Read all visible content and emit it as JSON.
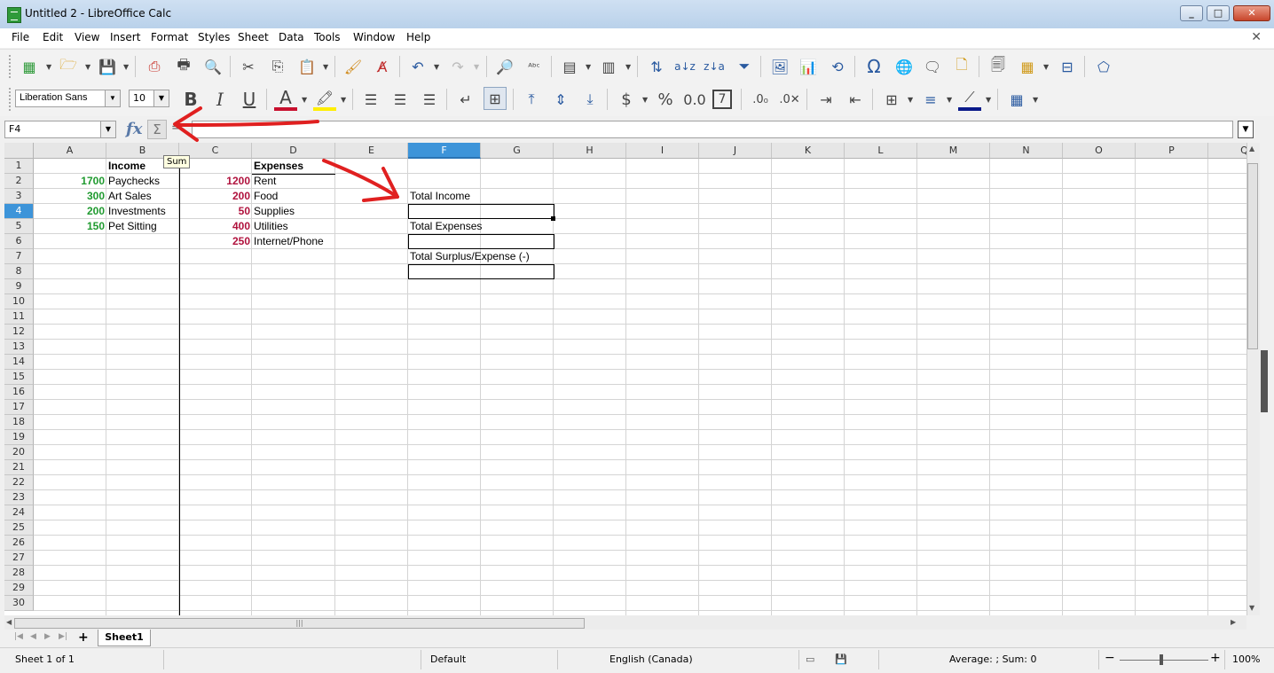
{
  "window": {
    "title": "Untitled 2 - LibreOffice Calc"
  },
  "menu": [
    "File",
    "Edit",
    "View",
    "Insert",
    "Format",
    "Styles",
    "Sheet",
    "Data",
    "Tools",
    "Window",
    "Help"
  ],
  "font": {
    "name": "Liberation Sans",
    "size": "10"
  },
  "formula_bar": {
    "cell_ref": "F4",
    "tooltip": "Sum"
  },
  "columns": [
    "A",
    "B",
    "C",
    "D",
    "E",
    "F",
    "G",
    "H",
    "I",
    "J",
    "K",
    "L",
    "M",
    "N",
    "O",
    "P",
    "Q"
  ],
  "rows": [
    "1",
    "2",
    "3",
    "4",
    "5",
    "6",
    "7",
    "8",
    "9",
    "10",
    "11",
    "12",
    "13",
    "14",
    "15",
    "16",
    "17",
    "18",
    "19",
    "20",
    "21",
    "22",
    "23",
    "24",
    "25",
    "26",
    "27",
    "28",
    "29",
    "30"
  ],
  "cells": {
    "B1": "Income",
    "D1": "Expenses",
    "A2": "1700",
    "B2": "Paychecks",
    "C2": "1200",
    "D2": "Rent",
    "A3": "300",
    "B3": "Art Sales",
    "C3": "200",
    "D3": "Food",
    "A4": "200",
    "B4": "Investments",
    "C4": "50",
    "D4": "Supplies",
    "A5": "150",
    "B5": "Pet Sitting",
    "C5": "400",
    "D5": "Utilities",
    "C6": "250",
    "D6": "Internet/Phone",
    "F3": "Total Income",
    "F5": "Total Expenses",
    "F7": "Total Surplus/Expense (-)"
  },
  "sheet_tab": "Sheet1",
  "status": {
    "sheet": "Sheet 1 of 1",
    "page_style": "Default",
    "language": "English (Canada)",
    "summary": "Average: ; Sum: 0",
    "zoom": "100%"
  },
  "colors": {
    "positive": "#1f9a2f",
    "negative": "#b0123d",
    "selection": "#3d94d9",
    "annotation": "#e02020"
  }
}
